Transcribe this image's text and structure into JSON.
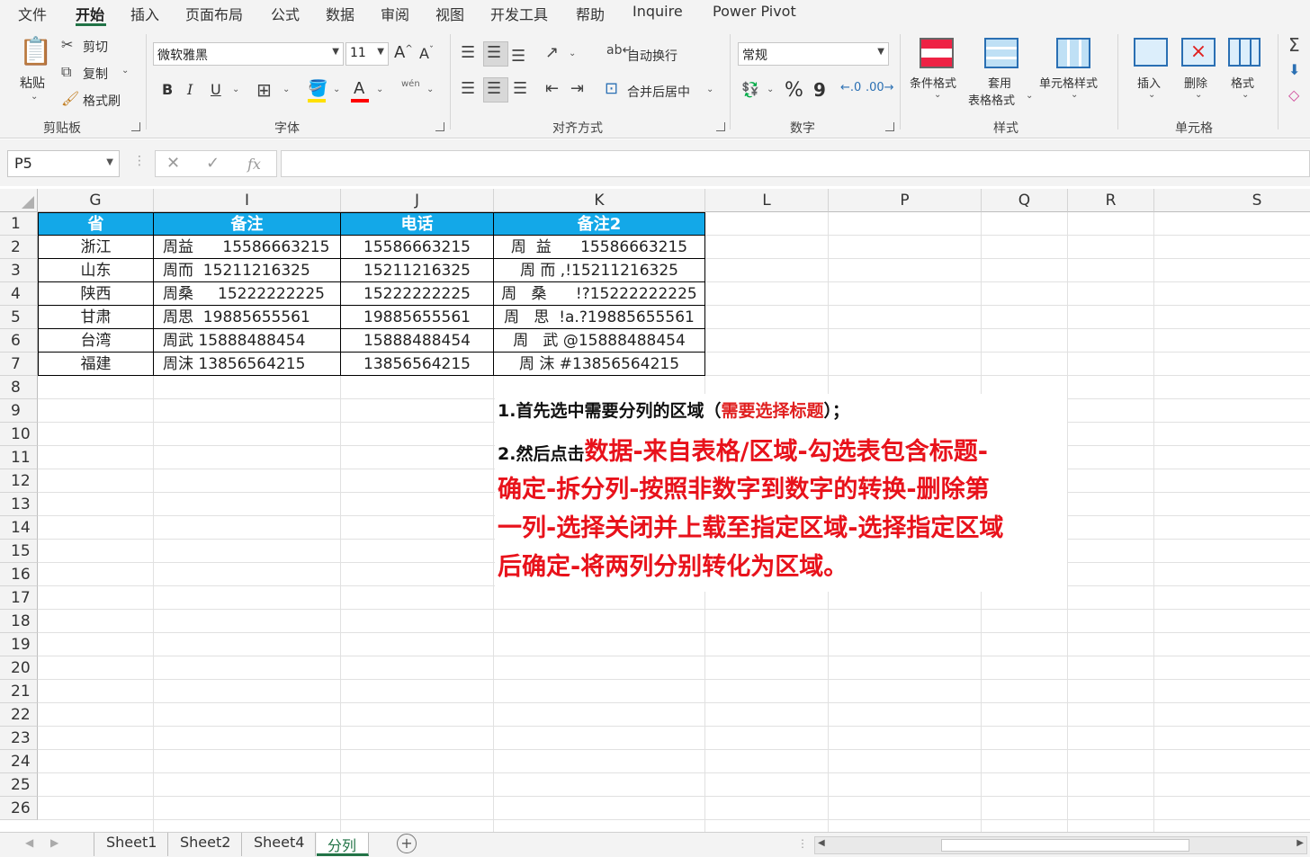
{
  "menu": {
    "items": [
      "文件",
      "开始",
      "插入",
      "页面布局",
      "公式",
      "数据",
      "审阅",
      "视图",
      "开发工具",
      "帮助",
      "Inquire",
      "Power Pivot"
    ]
  },
  "ribbon": {
    "clipboard": {
      "paste": "粘贴",
      "cut": "剪切",
      "copy": "复制",
      "format_painter": "格式刷",
      "label": "剪贴板"
    },
    "font": {
      "name": "微软雅黑",
      "size": "11",
      "bold": "B",
      "italic": "I",
      "underline": "U",
      "phonetic": "wén",
      "label": "字体"
    },
    "alignment": {
      "wrap": "自动换行",
      "merge": "合并后居中",
      "label": "对齐方式"
    },
    "number": {
      "format": "常规",
      "percent": "%",
      "comma": "9",
      "label": "数字"
    },
    "styles": {
      "conditional": "条件格式",
      "table_1": "套用",
      "table_2": "表格格式",
      "cell_styles": "单元格样式",
      "label": "样式"
    },
    "cells": {
      "insert": "插入",
      "delete": "删除",
      "format": "格式",
      "label": "单元格"
    }
  },
  "formula_bar": {
    "name_box": "P5",
    "fx": "fx",
    "value": ""
  },
  "sheet": {
    "columns": [
      "G",
      "I",
      "J",
      "K",
      "L",
      "P",
      "Q",
      "R",
      "S"
    ],
    "rows": [
      "1",
      "2",
      "3",
      "4",
      "5",
      "6",
      "7",
      "8",
      "9",
      "10",
      "11",
      "12",
      "13",
      "14",
      "15",
      "16",
      "17",
      "18",
      "19",
      "20",
      "21",
      "22",
      "23",
      "24",
      "25",
      "26"
    ],
    "table_header": [
      "省",
      "备注",
      "电话",
      "备注2"
    ],
    "table_rows": [
      [
        "浙江",
        "周益      15586663215",
        "15586663215",
        "周  益      15586663215"
      ],
      [
        "山东",
        "周而  15211216325",
        "15211216325",
        "周 而 ,!15211216325"
      ],
      [
        "陕西",
        "周桑     15222222225",
        "15222222225",
        "周   桑      !?15222222225"
      ],
      [
        "甘肃",
        "周思  19885655561",
        "19885655561",
        "周   思  !a.?19885655561"
      ],
      [
        "台湾",
        "周武 15888488454",
        "15888488454",
        "周   武 @15888488454"
      ],
      [
        "福建",
        "周沫 13856564215",
        "13856564215",
        "周 沫 #13856564215"
      ]
    ]
  },
  "annotation": {
    "line1_a": "1.首先选中需要分列的区域（",
    "line1_b": "需要选择标题",
    "line1_c": "）；",
    "line2_a": "2.然后点击",
    "line2_b": "数据-来自表格/区域-勾选表包含标题-",
    "line3": "确定-拆分列-按照非数字到数字的转换-删除第",
    "line4": "一列-选择关闭并上载至指定区域-选择指定区域",
    "line5": "后确定-将两列分别转化为区域。"
  },
  "tabs": [
    "Sheet1",
    "Sheet2",
    "Sheet4",
    "分列"
  ],
  "colors": {
    "header_fill": "#13a8e8",
    "accent": "#217346",
    "annotation_red": "#e8121b"
  }
}
